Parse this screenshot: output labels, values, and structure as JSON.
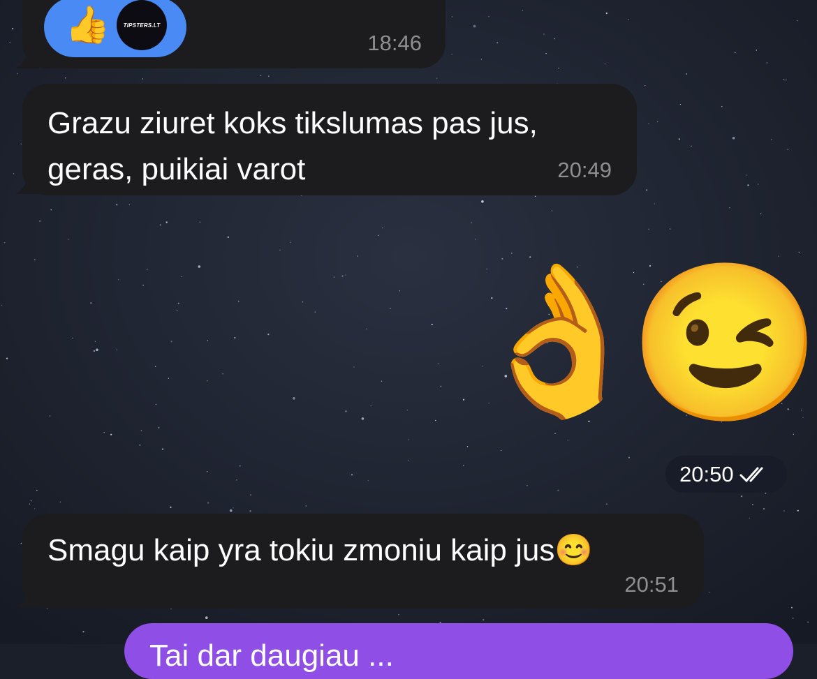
{
  "chat": {
    "messages": [
      {
        "direction": "incoming",
        "text": "",
        "time": "18:46",
        "reaction": {
          "emoji": "👍",
          "emoji_icon": "thumbs-up-icon",
          "avatar_text": "TIPSTERS.LT"
        }
      },
      {
        "direction": "incoming",
        "text": "Grazu ziuret koks tikslumas pas jus, geras,  puikiai varot",
        "time": "20:49"
      },
      {
        "direction": "outgoing",
        "type": "emoji",
        "emoji_1": "👌",
        "emoji_1_icon": "ok-hand-icon",
        "emoji_2": "😉",
        "emoji_2_icon": "winking-face-icon",
        "time": "20:50",
        "status": "read",
        "status_icon": "double-check-icon"
      },
      {
        "direction": "incoming",
        "text": "Smagu kaip yra tokiu zmoniu kaip jus😊",
        "time": "20:51"
      },
      {
        "direction": "outgoing",
        "text": "Tai dar daugiau ...",
        "time": ""
      }
    ]
  },
  "colors": {
    "incoming_bubble": "#1c1c1e",
    "outgoing_bubble": "#8f4ee6",
    "reaction_bg": "#4a8af5",
    "timestamp": "#8e8e93",
    "wallpaper": "#1b1f2a"
  }
}
